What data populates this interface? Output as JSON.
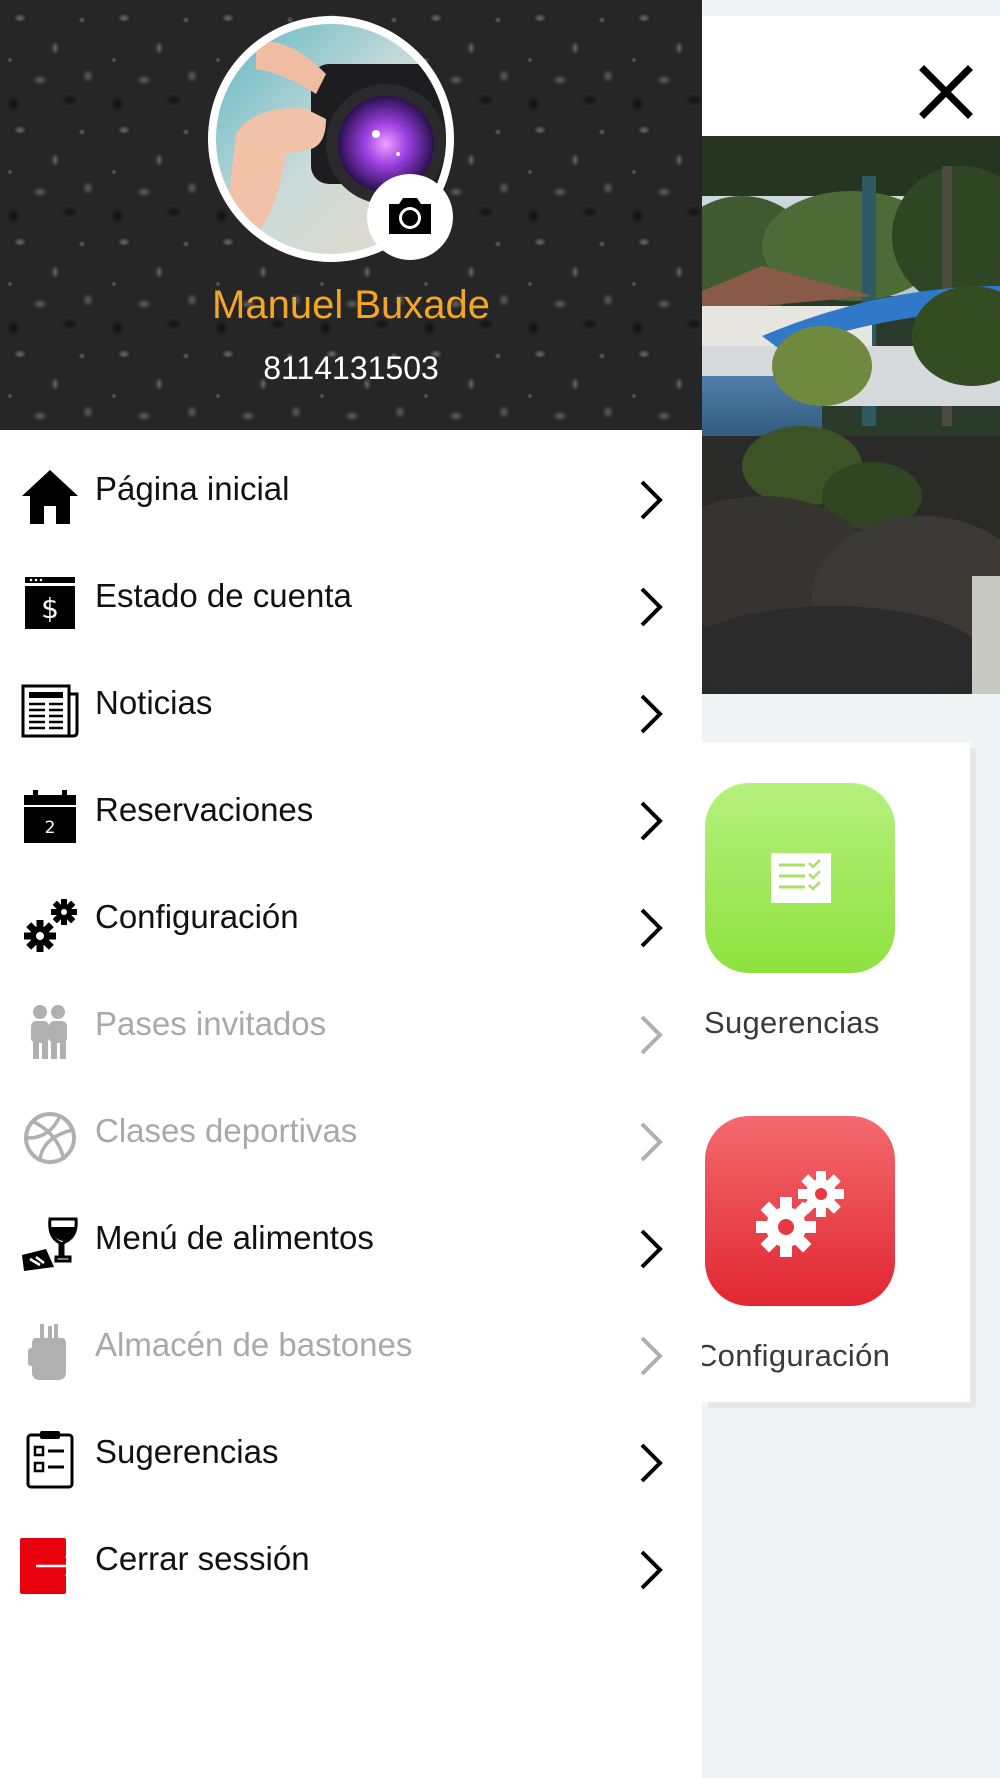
{
  "profile": {
    "name": "Manuel Buxade",
    "phone": "8114131503"
  },
  "menu": [
    {
      "label": "Página inicial",
      "icon": "home-icon",
      "enabled": true
    },
    {
      "label": "Estado de cuenta",
      "icon": "dollar-statement-icon",
      "enabled": true
    },
    {
      "label": "Noticias",
      "icon": "newspaper-icon",
      "enabled": true
    },
    {
      "label": "Reservaciones",
      "icon": "calendar-icon",
      "enabled": true
    },
    {
      "label": "Configuración",
      "icon": "gears-icon",
      "enabled": true
    },
    {
      "label": "Pases invitados",
      "icon": "guests-icon",
      "enabled": false
    },
    {
      "label": "Clases deportivas",
      "icon": "sports-ball-icon",
      "enabled": false
    },
    {
      "label": "Menú de alimentos",
      "icon": "wine-glass-icon",
      "enabled": true
    },
    {
      "label": "Almacén de bastones",
      "icon": "golf-bag-icon",
      "enabled": false
    },
    {
      "label": "Sugerencias",
      "icon": "clipboard-icon",
      "enabled": true
    },
    {
      "label": "Cerrar sessión",
      "icon": "logout-icon",
      "enabled": true
    }
  ],
  "background": {
    "tiles": [
      {
        "label": "Sugerencias",
        "icon": "suggestions-list-icon",
        "color": "#8ee23e"
      },
      {
        "label": "Configuración",
        "icon": "gears-icon",
        "color": "#e12631"
      }
    ]
  },
  "colors": {
    "accent": "#f5a623",
    "text": "#111111",
    "disabled_text": "#a9a9a9",
    "logout_red": "#e8000d"
  }
}
